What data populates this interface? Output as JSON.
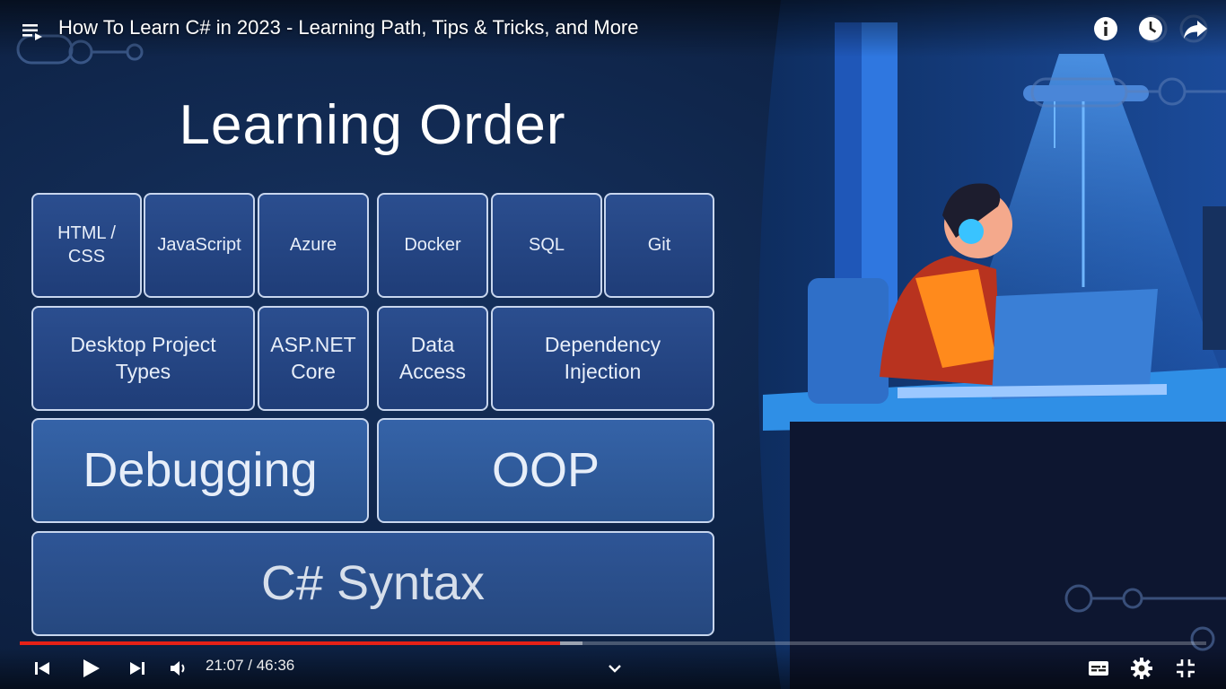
{
  "player": {
    "title": "How To Learn C# in 2023 - Learning Path, Tips & Tricks, and More",
    "time_display": "21:07 / 46:36",
    "progress_fraction": 0.455,
    "buffered_fraction": 0.474,
    "top_icons": [
      "info-icon",
      "watch-later-clock-icon",
      "share-arrow-icon"
    ],
    "bottom_icons": [
      "previous-icon",
      "play-icon",
      "next-icon",
      "volume-icon",
      "chevron-down-icon",
      "subtitles-icon",
      "settings-gear-icon",
      "exit-fullscreen-icon"
    ],
    "accent_color": "#e62117"
  },
  "slide": {
    "title": "Learning Order",
    "row1": [
      "HTML /\nCSS",
      "JavaScript",
      "Azure",
      "Docker",
      "SQL",
      "Git"
    ],
    "row2": [
      "Desktop Project\nTypes",
      "ASP.NET\nCore",
      "Data\nAccess",
      "Dependency\nInjection"
    ],
    "row3": [
      "Debugging",
      "OOP"
    ],
    "row4": [
      "C# Syntax"
    ]
  }
}
